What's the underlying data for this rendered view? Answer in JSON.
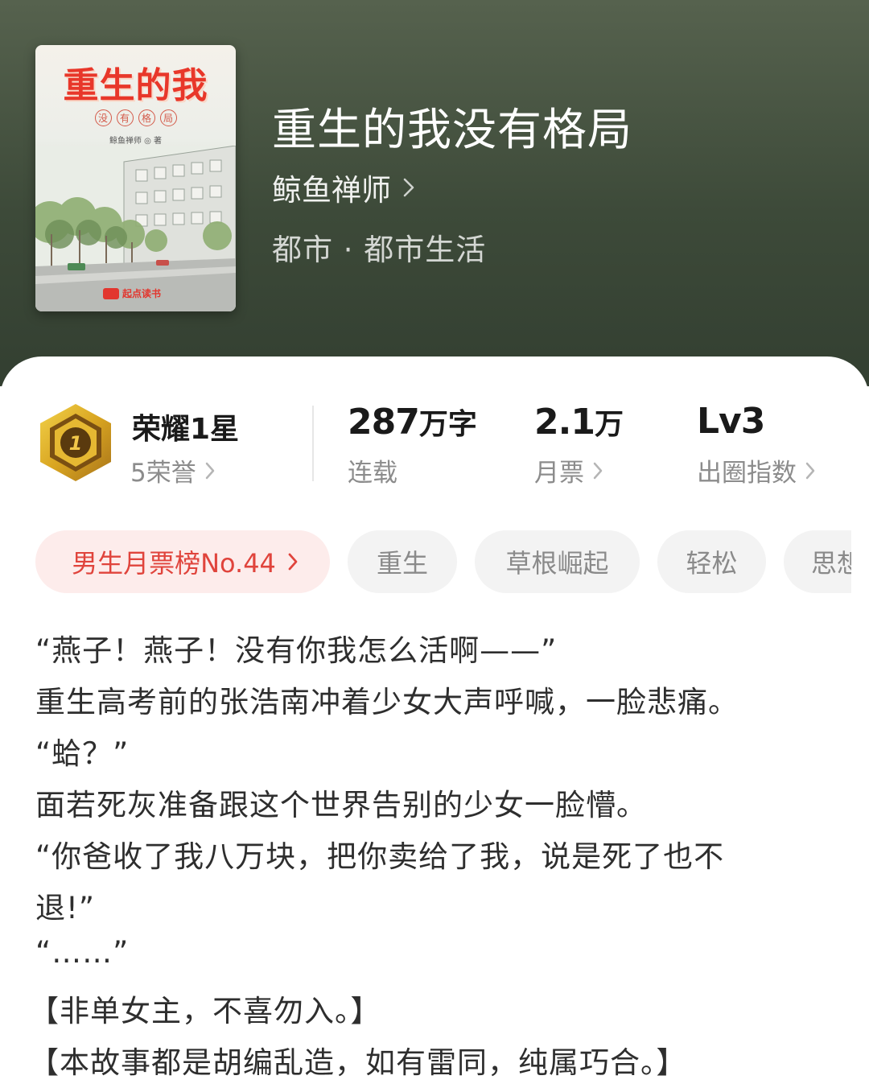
{
  "book": {
    "cover": {
      "title": "重生的我",
      "subtitle_chars": [
        "没",
        "有",
        "格",
        "局"
      ],
      "author_line": "鲸鱼禅师 ◎ 著",
      "brand": "起点读书"
    },
    "title": "重生的我没有格局",
    "author": "鲸鱼禅师",
    "genre": "都市 · 都市生活"
  },
  "stats": {
    "honor": {
      "title": "荣耀1星",
      "sub": "5荣誉",
      "badge_number": "1"
    },
    "words": {
      "value": "287",
      "unit": "万字",
      "label": "连载"
    },
    "tickets": {
      "value": "2.1",
      "unit": "万",
      "label": "月票"
    },
    "level": {
      "value": "Lv3",
      "label": "出圈指数"
    }
  },
  "tags": {
    "rank": "男生月票榜No.44",
    "items": [
      "重生",
      "草根崛起",
      "轻松",
      "思想"
    ]
  },
  "synopsis": [
    "“燕子！燕子！没有你我怎么活啊——”",
    "重生高考前的张浩南冲着少女大声呼喊，一脸悲痛。",
    "“蛤？”",
    "面若死灰准备跟这个世界告别的少女一脸懵。",
    "“你爸收了我八万块，把你卖给了我，说是死了也不",
    "退!”",
    "“……”",
    "【非单女主，不喜勿入。】",
    "【本故事都是胡编乱造，如有雷同，纯属巧合。】"
  ],
  "colors": {
    "header_bg": "#3d4a39",
    "rank_tag_bg": "#fdeceb",
    "rank_tag_text": "#e0443c",
    "tag_bg": "#f3f3f3",
    "badge_gold": "#d9a521"
  }
}
